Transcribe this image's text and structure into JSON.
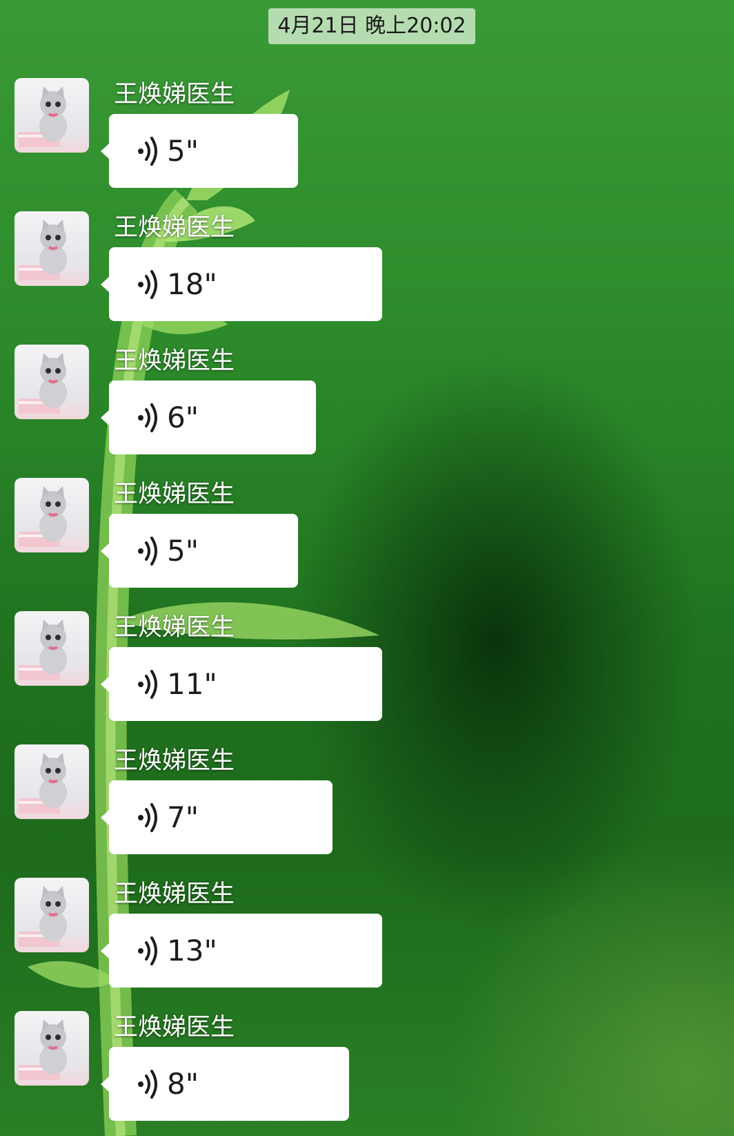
{
  "timestamp": "4月21日 晚上20:02",
  "messages": [
    {
      "sender": "王焕娣医生",
      "duration": "5\""
    },
    {
      "sender": "王焕娣医生",
      "duration": "18\""
    },
    {
      "sender": "王焕娣医生",
      "duration": "6\""
    },
    {
      "sender": "王焕娣医生",
      "duration": "5\""
    },
    {
      "sender": "王焕娣医生",
      "duration": "11\""
    },
    {
      "sender": "王焕娣医生",
      "duration": "7\""
    },
    {
      "sender": "王焕娣医生",
      "duration": "13\""
    },
    {
      "sender": "王焕娣医生",
      "duration": "8\""
    }
  ],
  "icons": {
    "avatar": "kitten-avatar-icon",
    "voice": "voice-wave-icon"
  },
  "colors": {
    "bubble": "#ffffff",
    "timestamp_bg": "#b5dcb0",
    "chat_bg": "#2c8a2a"
  }
}
